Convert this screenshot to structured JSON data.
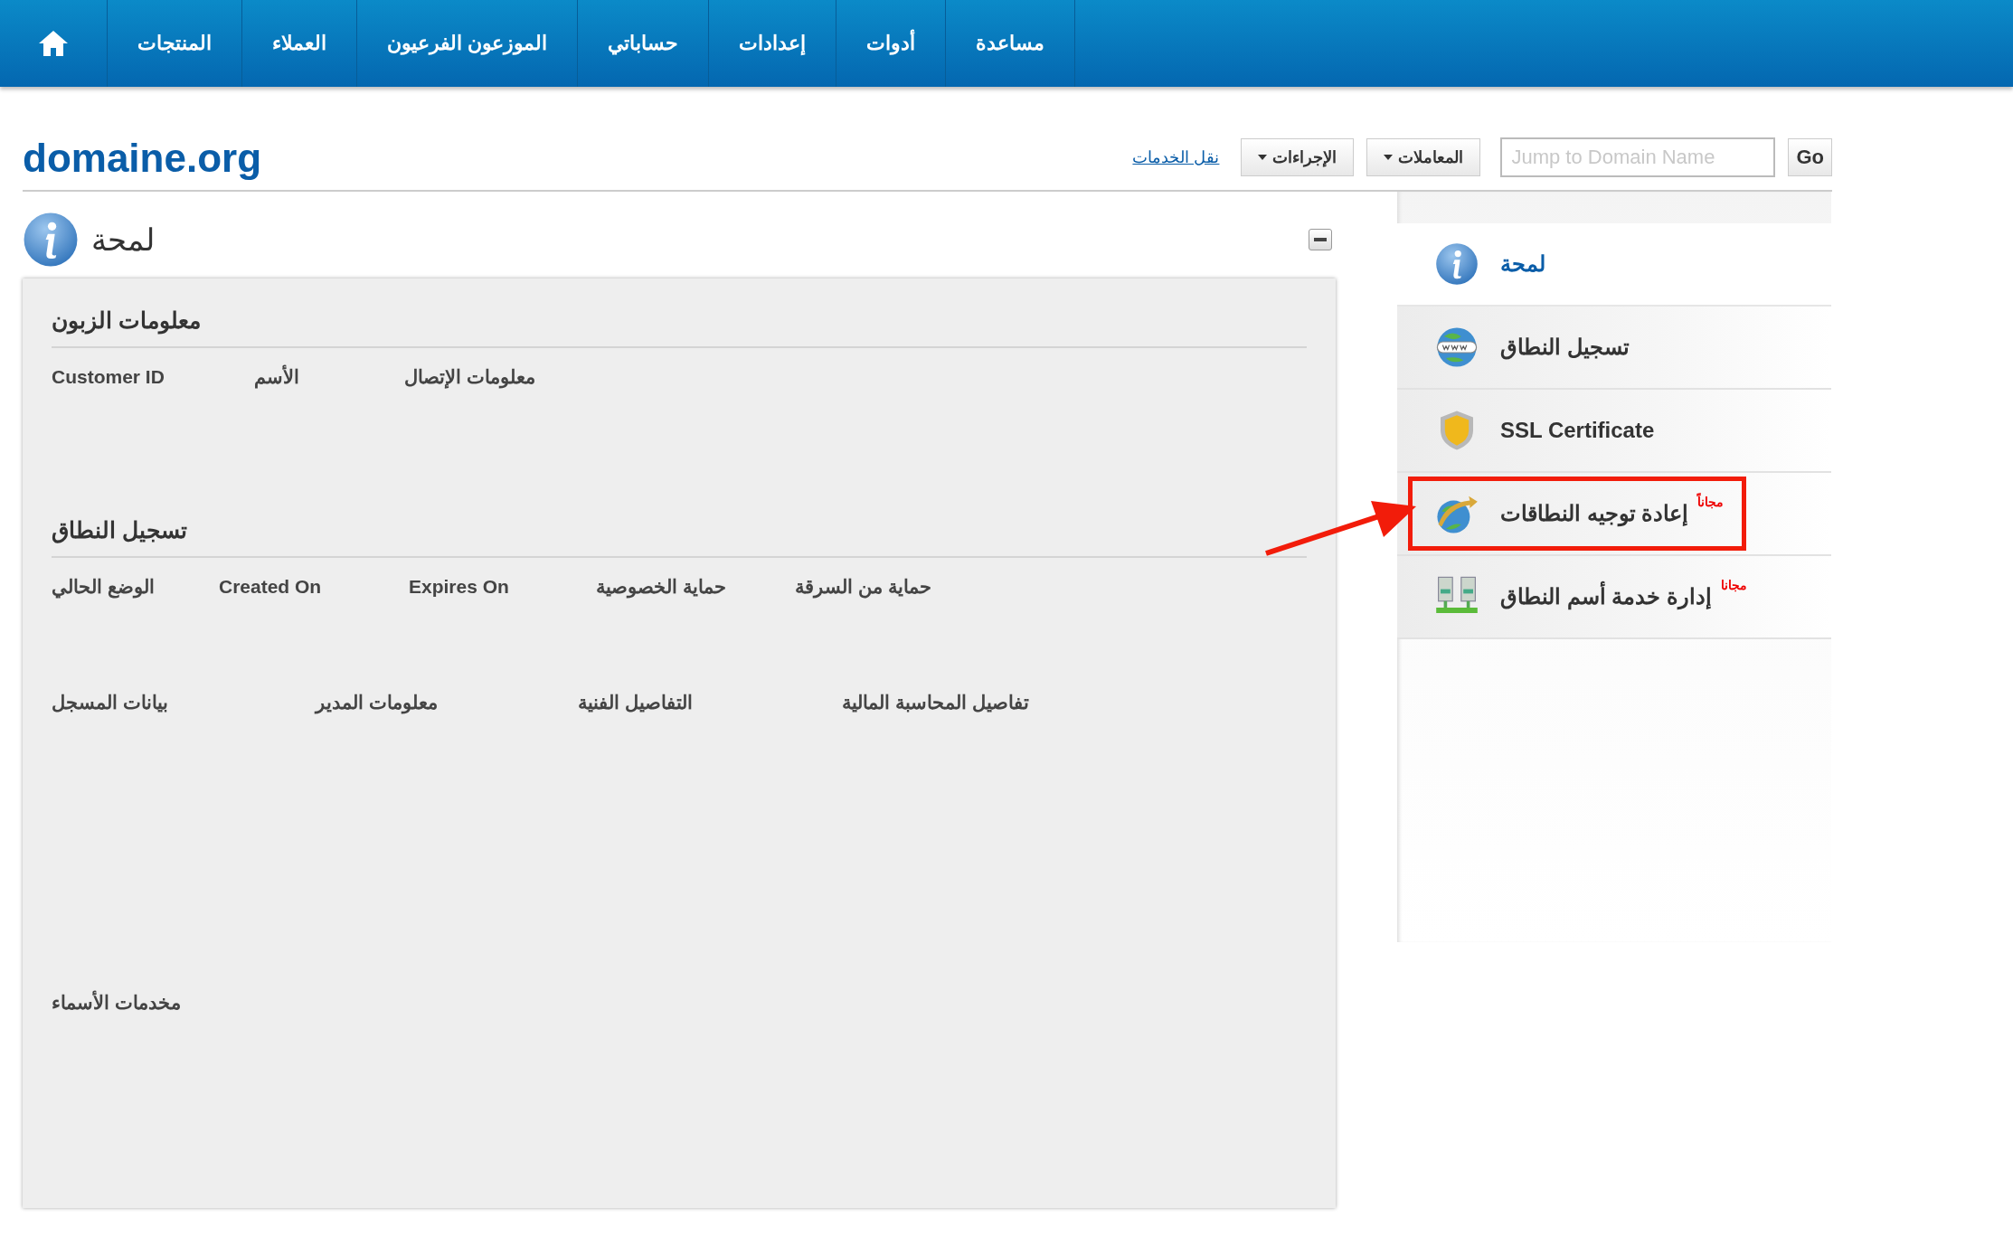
{
  "nav": {
    "items": [
      {
        "label": "مساعدة"
      },
      {
        "label": "أدوات"
      },
      {
        "label": "إعدادات"
      },
      {
        "label": "حساباتي"
      },
      {
        "label": "الموزعون الفرعيون"
      },
      {
        "label": "العملاء"
      },
      {
        "label": "المنتجات"
      }
    ]
  },
  "header": {
    "title": "domaine.org",
    "search": {
      "placeholder": "Jump to Domain Name"
    },
    "go": "Go",
    "menus": [
      "المعاملات",
      "الإجراءات"
    ],
    "link": "نقل الخدمات"
  },
  "panel": {
    "title": "لمحة",
    "sections": [
      {
        "heading": "معلومات الزبون",
        "groups": [
          {
            "labels": [
              "معلومات الإتصال",
              "الأسم",
              "Customer ID"
            ]
          }
        ]
      },
      {
        "heading": "تسجيل النطاق",
        "groups": [
          {
            "labels": [
              "حماية من السرقة",
              "حماية الخصوصية",
              "Expires On",
              "Created On",
              "الوضع الحالي"
            ]
          },
          {
            "labels": [
              "تفاصيل المحاسبة المالية",
              "التفاصيل الفنية",
              "معلومات المدير",
              "بيانات المسجل"
            ]
          },
          {
            "labels": [
              "مخدمات الأسماء"
            ]
          }
        ]
      }
    ]
  },
  "sidebar": {
    "items": [
      {
        "label": "لمحة",
        "kind": "info",
        "selected": true,
        "highlighted": false
      },
      {
        "label": "تسجيل النطاق",
        "kind": "www",
        "selected": false,
        "highlighted": false
      },
      {
        "label": "SSL Certificate",
        "kind": "shield",
        "selected": false,
        "highlighted": false
      },
      {
        "label": "إعادة توجيه النطاقات",
        "badge": "مجاناً",
        "kind": "redirect",
        "selected": false,
        "highlighted": true
      },
      {
        "label": "إدارة خدمة أسم النطاق",
        "badge": "مجانا",
        "kind": "servers",
        "selected": false,
        "highlighted": false
      }
    ]
  }
}
